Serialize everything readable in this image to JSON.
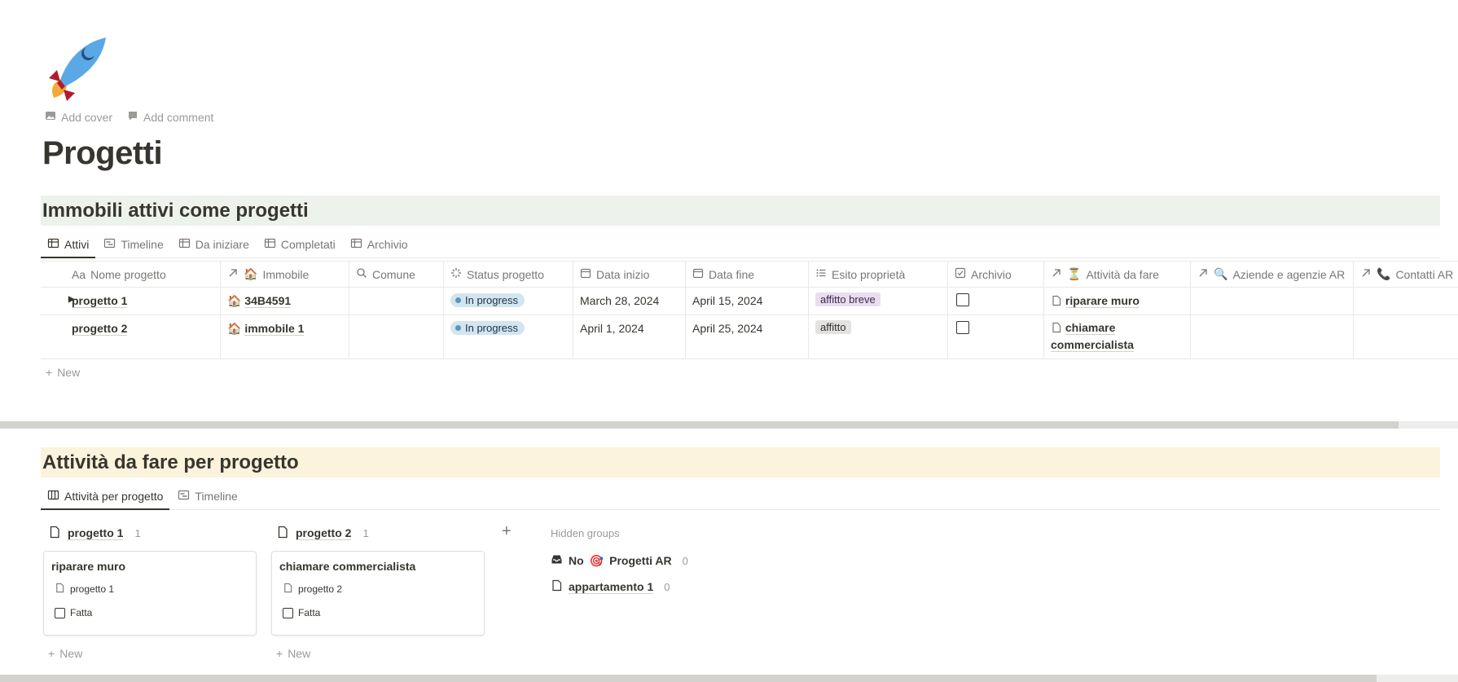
{
  "page": {
    "icon": "rocket-icon",
    "add_cover": "Add cover",
    "add_comment": "Add comment",
    "title": "Progetti"
  },
  "section1": {
    "heading": "Immobili attivi come progetti",
    "tabs": [
      {
        "label": "Attivi",
        "icon": "table-icon",
        "active": true
      },
      {
        "label": "Timeline",
        "icon": "timeline-icon"
      },
      {
        "label": "Da iniziare",
        "icon": "table-icon"
      },
      {
        "label": "Completati",
        "icon": "table-icon"
      },
      {
        "label": "Archivio",
        "icon": "table-icon"
      }
    ],
    "columns": [
      {
        "label": "Nome progetto",
        "icon": "text-icon",
        "prefix": "Aa"
      },
      {
        "label": "Immobile",
        "icon": "relation-arrow-icon",
        "emoji": "🏠"
      },
      {
        "label": "Comune",
        "icon": "search-icon"
      },
      {
        "label": "Status progetto",
        "icon": "status-icon"
      },
      {
        "label": "Data inizio",
        "icon": "calendar-icon"
      },
      {
        "label": "Data fine",
        "icon": "calendar-icon"
      },
      {
        "label": "Esito proprietà",
        "icon": "list-icon"
      },
      {
        "label": "Archivio",
        "icon": "checkbox-icon"
      },
      {
        "label": "Attività da fare",
        "icon": "relation-arrow-icon",
        "emoji": "⏳"
      },
      {
        "label": "Aziende e agenzie AR",
        "icon": "relation-arrow-icon",
        "emoji": "🔍"
      },
      {
        "label": "Contatti AR",
        "icon": "relation-arrow-icon",
        "emoji": "📞"
      }
    ],
    "rows": [
      {
        "name": "progetto 1",
        "immobile_emoji": "🏠",
        "immobile": "34B4591",
        "comune": "",
        "status": "In progress",
        "data_inizio": "March 28, 2024",
        "data_fine": "April 15, 2024",
        "esito": "affitto breve",
        "archivio": false,
        "attivita": "riparare muro"
      },
      {
        "name": "progetto 2",
        "immobile_emoji": "🏠",
        "immobile": "immobile 1",
        "comune": "",
        "status": "In progress",
        "data_inizio": "April 1, 2024",
        "data_fine": "April 25, 2024",
        "esito": "affitto",
        "archivio": false,
        "attivita_line1": "chiamare",
        "attivita_line2": "commercialista"
      }
    ],
    "new_label": "New",
    "colors": {
      "status_bg": "#d3e5ef",
      "status_dot": "#5b97bd",
      "tag_purple": "#e8deee",
      "tag_gray": "#e3e2e0",
      "heading_bg": "#edf3ec"
    }
  },
  "section2": {
    "heading": "Attività da fare per progetto",
    "tabs": [
      {
        "label": "Attività per progetto",
        "icon": "board-icon",
        "active": true
      },
      {
        "label": "Timeline",
        "icon": "timeline-icon"
      }
    ],
    "groups": [
      {
        "name": "progetto 1",
        "count": "1",
        "card": {
          "title": "riparare muro",
          "project": "progetto 1",
          "check_label": "Fatta"
        }
      },
      {
        "name": "progetto 2",
        "count": "1",
        "card": {
          "title": "chiamare commercialista",
          "project": "progetto 2",
          "check_label": "Fatta"
        }
      }
    ],
    "new_label": "New",
    "hidden_groups": {
      "title": "Hidden groups",
      "items": [
        {
          "icon": "inbox-icon",
          "prefix": "No",
          "emoji": "🎯",
          "label": "Progetti AR",
          "count": "0"
        },
        {
          "icon": "page-icon",
          "label": "appartamento 1",
          "count": "0"
        }
      ]
    },
    "colors": {
      "heading_bg": "#fbf3db"
    }
  }
}
